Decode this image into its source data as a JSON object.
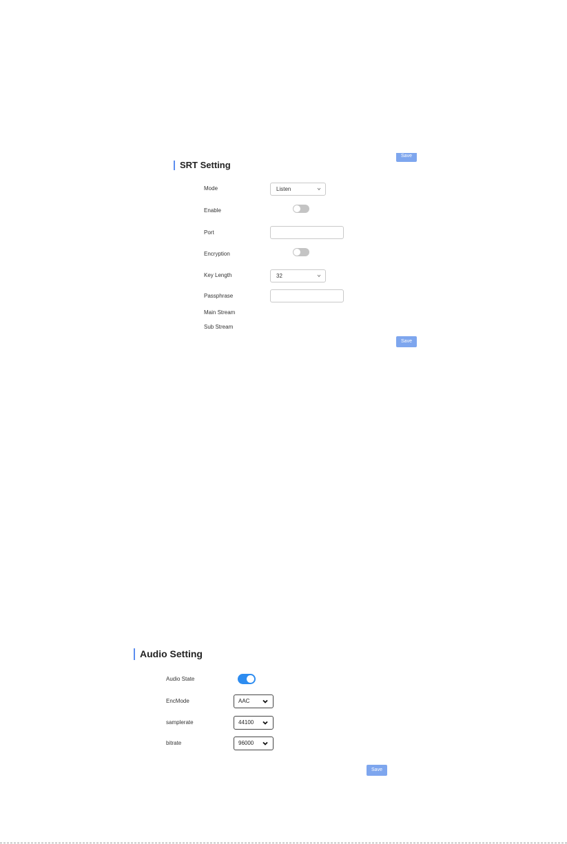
{
  "srt": {
    "title": "SRT Setting",
    "top_save_label": "Save",
    "bottom_save_label": "Save",
    "fields": {
      "mode_label": "Mode",
      "mode_value": "Listen",
      "enable_label": "Enable",
      "enable_on": false,
      "port_label": "Port",
      "port_value": "",
      "encryption_label": "Encryption",
      "encryption_on": false,
      "key_length_label": "Key Length",
      "key_length_value": "32",
      "passphrase_label": "Passphrase",
      "passphrase_value": "",
      "main_stream_label": "Main Stream",
      "sub_stream_label": "Sub Stream"
    }
  },
  "audio": {
    "title": "Audio Setting",
    "save_label": "Save",
    "fields": {
      "audio_state_label": "Audio State",
      "audio_state_on": true,
      "encmode_label": "EncMode",
      "encmode_value": "AAC",
      "samplerate_label": "samplerate",
      "samplerate_value": "44100",
      "bitrate_label": "bitrate",
      "bitrate_value": "96000"
    }
  },
  "icons": {
    "chevron_small": "chevron-down-icon",
    "chevron_bold": "chevron-down-icon"
  },
  "colors": {
    "accent": "#5b8def",
    "save_button": "#7ea6ee",
    "toggle_on": "#2d8cf0",
    "toggle_off": "#c4c4c4"
  }
}
